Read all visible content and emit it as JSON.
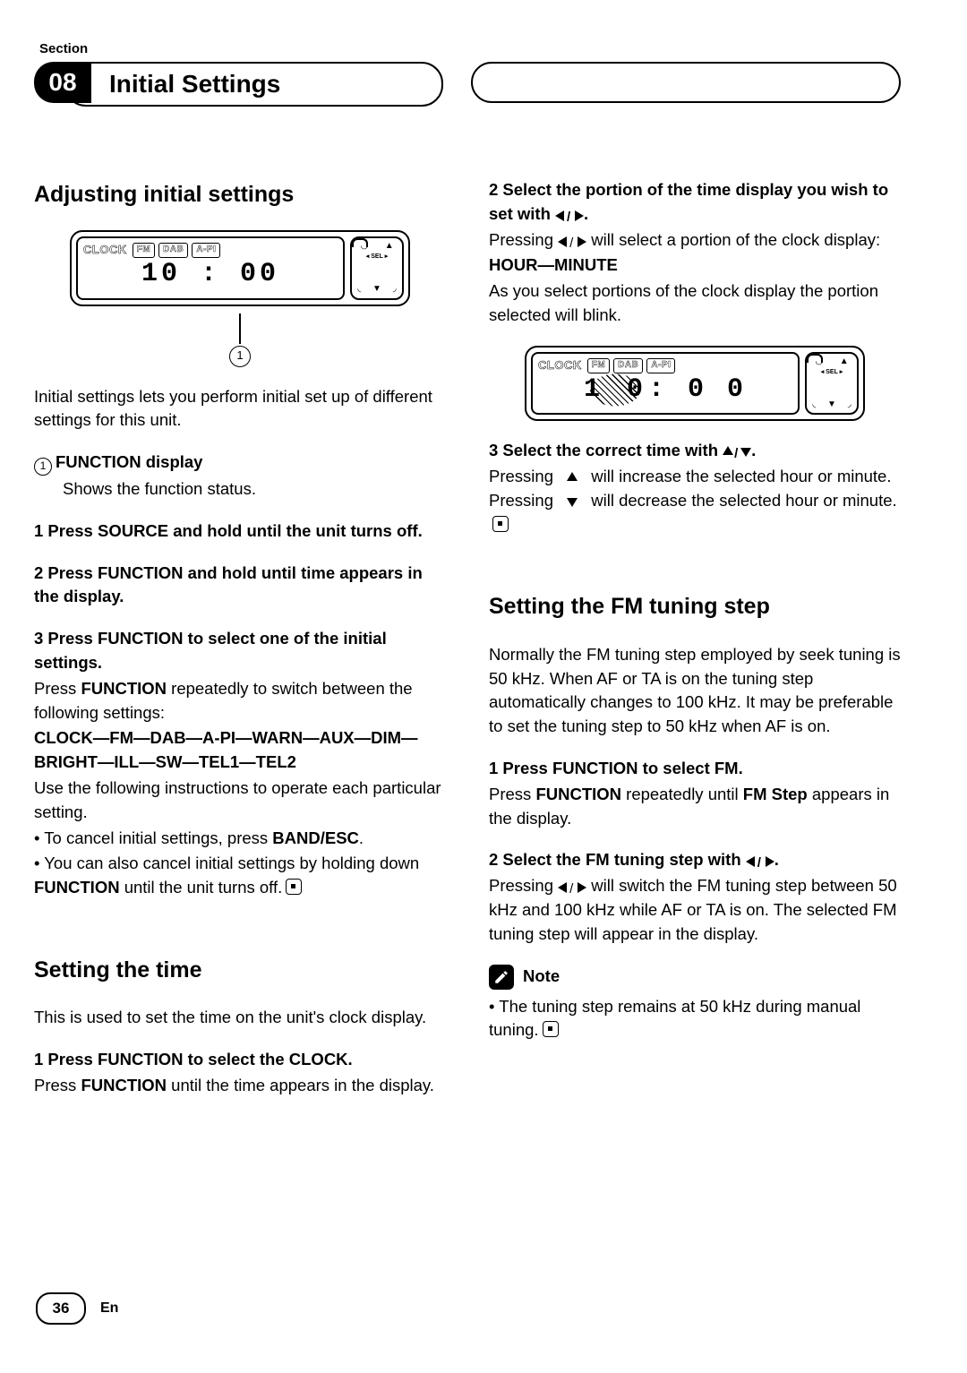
{
  "header": {
    "section_label": "Section",
    "section_number": "08",
    "title": "Initial Settings"
  },
  "left": {
    "h1": "Adjusting initial settings",
    "display": {
      "clock_label": "CLOCK",
      "tags": [
        "FM",
        "DAB",
        "A-PI"
      ],
      "time": "10 : 00",
      "side_top": "▲",
      "side_mid": "◂ SEL ▸",
      "side_low": "▼"
    },
    "callout": "1",
    "intro": "Initial settings lets you perform initial set up of different settings for this unit.",
    "func_label_num": "1",
    "func_label_bold": "FUNCTION display",
    "func_label_text": "Shows the function status.",
    "step1_bold": "1   Press SOURCE and hold until the unit turns off.",
    "step2_bold": "2   Press FUNCTION and hold until time appears in the display.",
    "step3_bold": "3   Press FUNCTION to select one of the initial settings.",
    "step3_p1a": "Press ",
    "step3_p1b": "FUNCTION",
    "step3_p1c": " repeatedly to switch between the following settings:",
    "settings_chain": "CLOCK—FM—DAB—A-PI—WARN—AUX—DIM—BRIGHT—ILL—SW—TEL1—TEL2",
    "step3_p2": "Use the following instructions to operate each particular setting.",
    "bullet1a": "• To cancel initial settings, press ",
    "bullet1b": "BAND/ESC",
    "bullet1c": ".",
    "bullet2a": "• You can also cancel initial settings by holding down ",
    "bullet2b": "FUNCTION",
    "bullet2c": " until the unit turns off.",
    "h2": "Setting the time",
    "time_intro": "This is used to set the time on the unit's clock display.",
    "time_step1_bold": "1   Press FUNCTION to select the CLOCK.",
    "time_step1_p_a": "Press ",
    "time_step1_p_b": "FUNCTION",
    "time_step1_p_c": " until the time appears in the display."
  },
  "right": {
    "step2_bold_a": "2   Select the portion of the time display you wish to set with ",
    "step2_bold_b": ".",
    "step2_p_a": "Pressing ",
    "step2_p_b": " will select a portion of the clock display:",
    "hm": "HOUR—MINUTE",
    "hm_after": "As you select portions of the clock display the portion selected will blink.",
    "display": {
      "clock_label": "CLOCK",
      "tags": [
        "FM",
        "DAB",
        "A-PI"
      ],
      "time_hour": "1 0",
      "time_rest": ": 0 0"
    },
    "step3_bold_a": "3   Select the correct time with ",
    "step3_bold_b": ".",
    "step3_p_a": "Pressing ",
    "step3_p_b": " will increase the selected hour or minute. Pressing ",
    "step3_p_c": " will decrease the selected hour or minute.",
    "h2": "Setting the FM tuning step",
    "fm_intro": "Normally the FM tuning step employed by seek tuning is 50 kHz. When AF or TA is on the tuning step automatically changes to 100 kHz. It may be preferable to set the tuning step to 50 kHz when AF is on.",
    "fm_step1_bold": "1   Press FUNCTION to select FM.",
    "fm_step1_p_a": "Press ",
    "fm_step1_p_b": "FUNCTION",
    "fm_step1_p_c": " repeatedly until ",
    "fm_step1_p_d": "FM Step",
    "fm_step1_p_e": " appears in the display.",
    "fm_step2_bold_a": "2   Select the FM tuning step with ",
    "fm_step2_bold_b": ".",
    "fm_step2_p_a": "Pressing ",
    "fm_step2_p_b": " will switch the FM tuning step between 50 kHz and 100 kHz while AF or TA is on. The selected FM tuning step will appear in the display.",
    "note_label": "Note",
    "note_text": "• The tuning step remains at 50 kHz during manual tuning."
  },
  "footer": {
    "page": "36",
    "lang": "En"
  }
}
